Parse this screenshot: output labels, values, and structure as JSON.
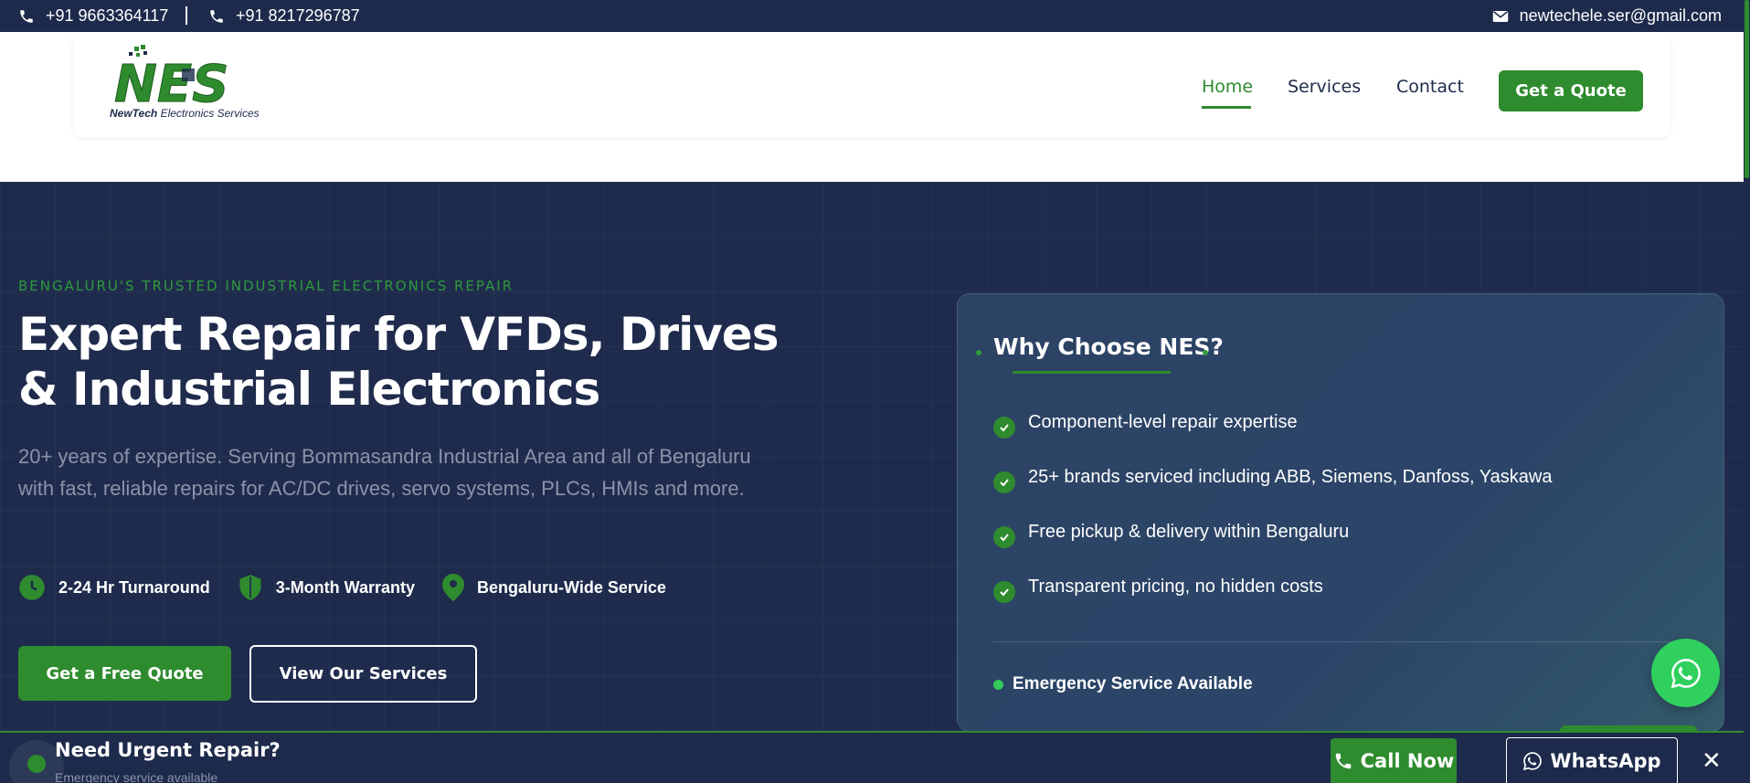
{
  "topbar": {
    "phone1": "+91 9663364117",
    "phone2": "+91 8217296787",
    "email": "newtechele.ser@gmail.com"
  },
  "logo": {
    "mark": "NES",
    "brand_bold": "NewTech",
    "brand_rest": " Electronics Services"
  },
  "nav": {
    "home": "Home",
    "services": "Services",
    "contact": "Contact",
    "quote": "Get a Quote"
  },
  "hero": {
    "eyebrow": "BENGALURU'S TRUSTED INDUSTRIAL ELECTRONICS REPAIR",
    "title": "Expert Repair for VFDs, Drives & Industrial Electronics",
    "description": "20+ years of expertise. Serving Bommasandra Industrial Area and all of Bengaluru with fast, reliable repairs for AC/DC drives, servo systems, PLCs, HMIs and more.",
    "features": [
      {
        "icon": "clock-icon",
        "label": "2-24 Hr Turnaround"
      },
      {
        "icon": "shield-icon",
        "label": "3-Month Warranty"
      },
      {
        "icon": "location-pin-icon",
        "label": "Bengaluru-Wide Service"
      }
    ],
    "cta_primary": "Get a Free Quote",
    "cta_secondary": "View Our Services"
  },
  "why": {
    "title": "Why Choose NES?",
    "items": [
      "Component-level repair expertise",
      "25+ brands serviced including ABB, Siemens, Danfoss, Yaskawa",
      "Free pickup & delivery within Bengaluru",
      "Transparent pricing, no hidden costs"
    ],
    "emergency": "Emergency Service Available"
  },
  "bottom_bar": {
    "title": "Need Urgent Repair?",
    "subtitle": "Emergency service available",
    "call": "Call Now",
    "whatsapp": "WhatsApp",
    "close": "✕"
  },
  "colors": {
    "navy": "#1d2a4b",
    "green": "#2e8b2e",
    "whatsapp_green": "#2fd05e"
  }
}
